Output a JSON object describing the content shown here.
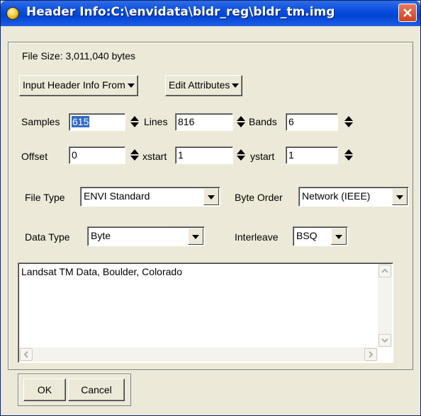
{
  "window": {
    "title": "Header Info:C:\\envidata\\bldr_reg\\bldr_tm.img",
    "file_size": "File Size: 3,011,040 bytes"
  },
  "menus": {
    "input_header": "Input Header Info From",
    "edit_attributes": "Edit Attributes"
  },
  "dimensions": {
    "samples_label": "Samples",
    "samples_value": "615",
    "lines_label": "Lines",
    "lines_value": "816",
    "bands_label": "Bands",
    "bands_value": "6"
  },
  "offsets": {
    "offset_label": "Offset",
    "offset_value": "0",
    "xstart_label": "xstart",
    "xstart_value": "1",
    "ystart_label": "ystart",
    "ystart_value": "1"
  },
  "file_type": {
    "label": "File Type",
    "value": "ENVI Standard"
  },
  "byte_order": {
    "label": "Byte Order",
    "value": "Network (IEEE)"
  },
  "data_type": {
    "label": "Data Type",
    "value": "Byte"
  },
  "interleave": {
    "label": "Interleave",
    "value": "BSQ"
  },
  "description": "Landsat TM Data, Boulder, Colorado",
  "buttons": {
    "ok": "OK",
    "cancel": "Cancel"
  },
  "colors": {
    "title_bar": "#0a4ee0",
    "close_button": "#d0401c",
    "dialog_bg": "#ece9d8",
    "selection": "#316ac5"
  }
}
